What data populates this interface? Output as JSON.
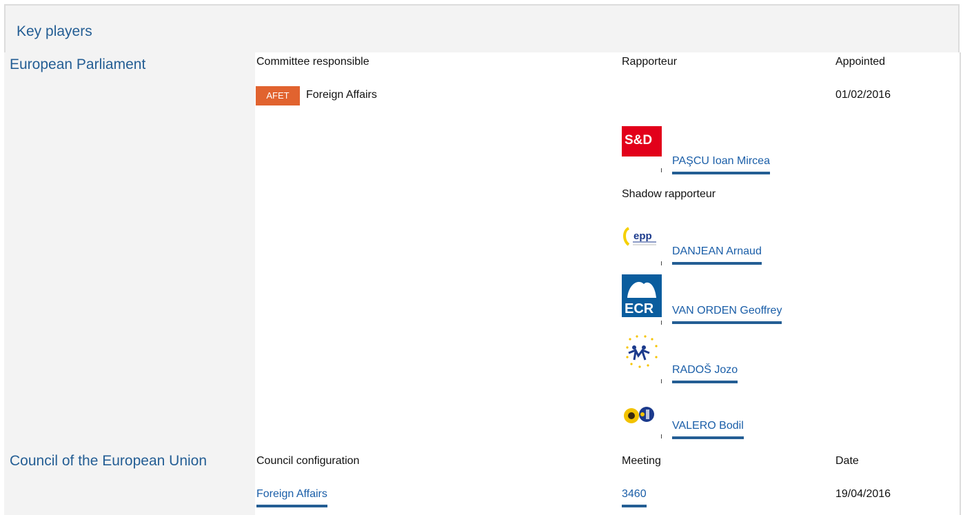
{
  "header": {
    "title": "Key players"
  },
  "parliament": {
    "label": "European Parliament",
    "columns": {
      "committee": "Committee responsible",
      "rapporteur": "Rapporteur",
      "appointed": "Appointed"
    },
    "committee": {
      "code": "AFET",
      "name": "Foreign Affairs",
      "appointed": "01/02/2016"
    },
    "rapporteur": {
      "group": "S&D",
      "name": "PAŞCU Ioan Mircea"
    },
    "shadow_label": "Shadow rapporteur",
    "shadows": [
      {
        "group": "epp",
        "name": "DANJEAN Arnaud"
      },
      {
        "group": "ECR",
        "name": "VAN ORDEN Geoffrey"
      },
      {
        "group": "EFDD",
        "name": "RADOŠ Jozo"
      },
      {
        "group": "Greens/EFA",
        "name": "VALERO Bodil"
      }
    ]
  },
  "council": {
    "label": "Council of the European Union",
    "columns": {
      "configuration": "Council configuration",
      "meeting": "Meeting",
      "date": "Date"
    },
    "row": {
      "configuration": "Foreign Affairs",
      "meeting": "3460",
      "date": "19/04/2016"
    }
  },
  "colors": {
    "accent": "#245e94",
    "tag": "#e1632f",
    "panel": "#f3f3f3"
  }
}
